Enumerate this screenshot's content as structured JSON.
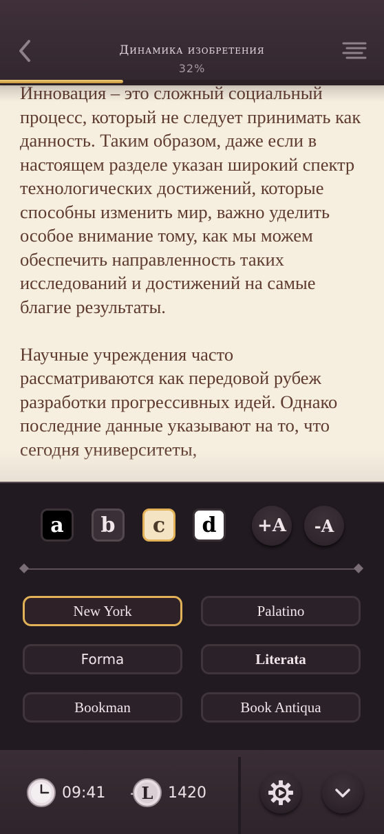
{
  "header": {
    "title": "Динамика изобретения",
    "progress": "32%",
    "progress_fraction": 0.32
  },
  "reader": {
    "paragraphs": [
      "Инновация – это сложный социальный процесс, который не следует принимать как данность. Таким образом, даже если в настоящем разделе указан широкий спектр технологических достижений, которые способны изменить мир, важно уделить особое внимание тому, как мы можем обеспечить направленность таких исследований и достижений на самые благие результаты.",
      "Научные учреждения часто рассматриваются как передовой рубеж разработки прогрессивных идей. Однако последние данные указывают на то, что сегодня университеты,"
    ]
  },
  "settings": {
    "themes": [
      {
        "label": "a",
        "name": "dark"
      },
      {
        "label": "b",
        "name": "dim"
      },
      {
        "label": "c",
        "name": "sepia",
        "selected": true
      },
      {
        "label": "d",
        "name": "light"
      }
    ],
    "increase_label": "+A",
    "decrease_label": "-A",
    "fonts": [
      {
        "label": "New York",
        "selected": true
      },
      {
        "label": "Palatino"
      },
      {
        "label": "Forma"
      },
      {
        "label": "Literata"
      },
      {
        "label": "Bookman"
      },
      {
        "label": "Book Antiqua"
      }
    ]
  },
  "footer": {
    "time": "09:41",
    "coins": "1420"
  },
  "colors": {
    "accent": "#e2b258",
    "page_bg": "#f6efdf",
    "text": "#5e3a2f",
    "panel_bg": "#211a20"
  }
}
